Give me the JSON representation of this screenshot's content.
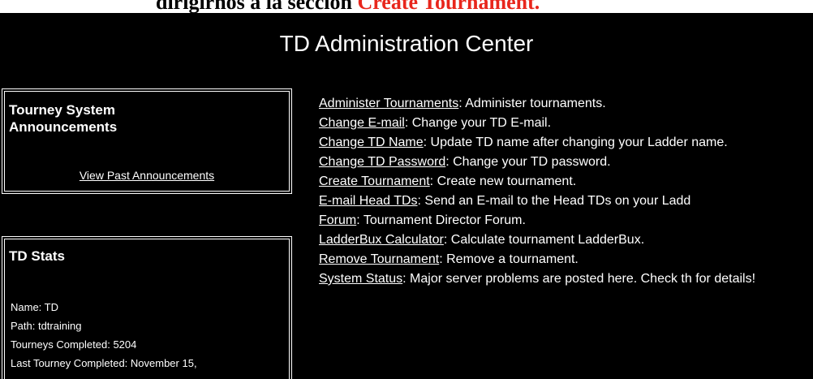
{
  "doc_caption": {
    "prefix": "dirígirnos a la sección ",
    "section": "Create Tournament."
  },
  "page_title": "TD Administration Center",
  "announcements": {
    "heading": "Tourney System Announcements",
    "past_link": "View Past Announcements"
  },
  "stats": {
    "heading": "TD Stats",
    "items": [
      "Name: TD",
      "Path: tdtraining",
      "Tourneys Completed: 5204",
      "Last Tourney Completed: November 15,"
    ]
  },
  "menu": [
    {
      "link": "Administer Tournaments",
      "desc": ": Administer tournaments."
    },
    {
      "link": "Change E-mail",
      "desc": ": Change your TD E-mail."
    },
    {
      "link": "Change TD Name",
      "desc": ": Update TD name after changing your Ladder name."
    },
    {
      "link": "Change TD Password",
      "desc": ": Change your TD password."
    },
    {
      "link": "Create Tournament",
      "desc": ": Create new tournament."
    },
    {
      "link": "E-mail Head TDs",
      "desc": ": Send an E-mail to the Head TDs on your Ladd"
    },
    {
      "link": "Forum",
      "desc": ": Tournament Director Forum."
    },
    {
      "link": "LadderBux Calculator",
      "desc": ": Calculate tournament LadderBux."
    },
    {
      "link": "Remove Tournament",
      "desc": ": Remove a tournament."
    },
    {
      "link": "System Status",
      "desc": ": Major server problems are posted here. Check th for details!"
    }
  ]
}
